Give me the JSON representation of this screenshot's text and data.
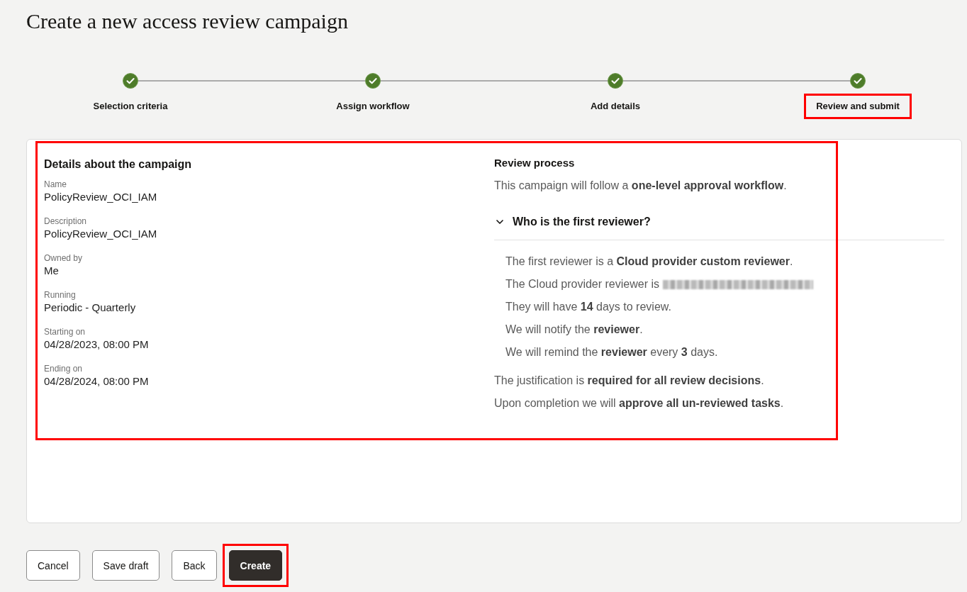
{
  "title": "Create a new access review campaign",
  "steps": [
    {
      "label": "Selection criteria",
      "completed": true,
      "highlighted": false
    },
    {
      "label": "Assign workflow",
      "completed": true,
      "highlighted": false
    },
    {
      "label": "Add details",
      "completed": true,
      "highlighted": false
    },
    {
      "label": "Review and submit",
      "completed": true,
      "highlighted": true
    }
  ],
  "summary": {
    "highlighted": true,
    "details": {
      "heading": "Details about the campaign",
      "fields": [
        {
          "label": "Name",
          "value": "PolicyReview_OCI_IAM"
        },
        {
          "label": "Description",
          "value": "PolicyReview_OCI_IAM"
        },
        {
          "label": "Owned by",
          "value": "Me"
        },
        {
          "label": "Running",
          "value": "Periodic - Quarterly"
        },
        {
          "label": "Starting on",
          "value": "04/28/2023, 08:00 PM"
        },
        {
          "label": "Ending on",
          "value": "04/28/2024, 08:00 PM"
        }
      ]
    },
    "review_process": {
      "heading": "Review process",
      "intro": "This campaign will follow a **one-level approval workflow**.",
      "section": {
        "title": "Who is the first reviewer?",
        "expanded": true,
        "lines": [
          {
            "text": "The first reviewer is a **Cloud provider custom reviewer**.",
            "redacted": false
          },
          {
            "text": "The Cloud provider reviewer is",
            "redacted": true
          },
          {
            "text": "They will have **14** days to review.",
            "redacted": false
          },
          {
            "text": "We will notify the **reviewer**.",
            "redacted": false
          },
          {
            "text": "We will remind the **reviewer** every **3** days.",
            "redacted": false
          }
        ]
      },
      "notes": [
        "The justification is **required for all review decisions**.",
        "Upon completion we will **approve all un-reviewed tasks**."
      ]
    }
  },
  "buttons": [
    {
      "label": "Cancel",
      "kind": "secondary",
      "highlighted": false
    },
    {
      "label": "Save draft",
      "kind": "secondary",
      "highlighted": false
    },
    {
      "label": "Back",
      "kind": "secondary",
      "highlighted": false
    },
    {
      "label": "Create",
      "kind": "primary",
      "highlighted": true
    }
  ]
}
